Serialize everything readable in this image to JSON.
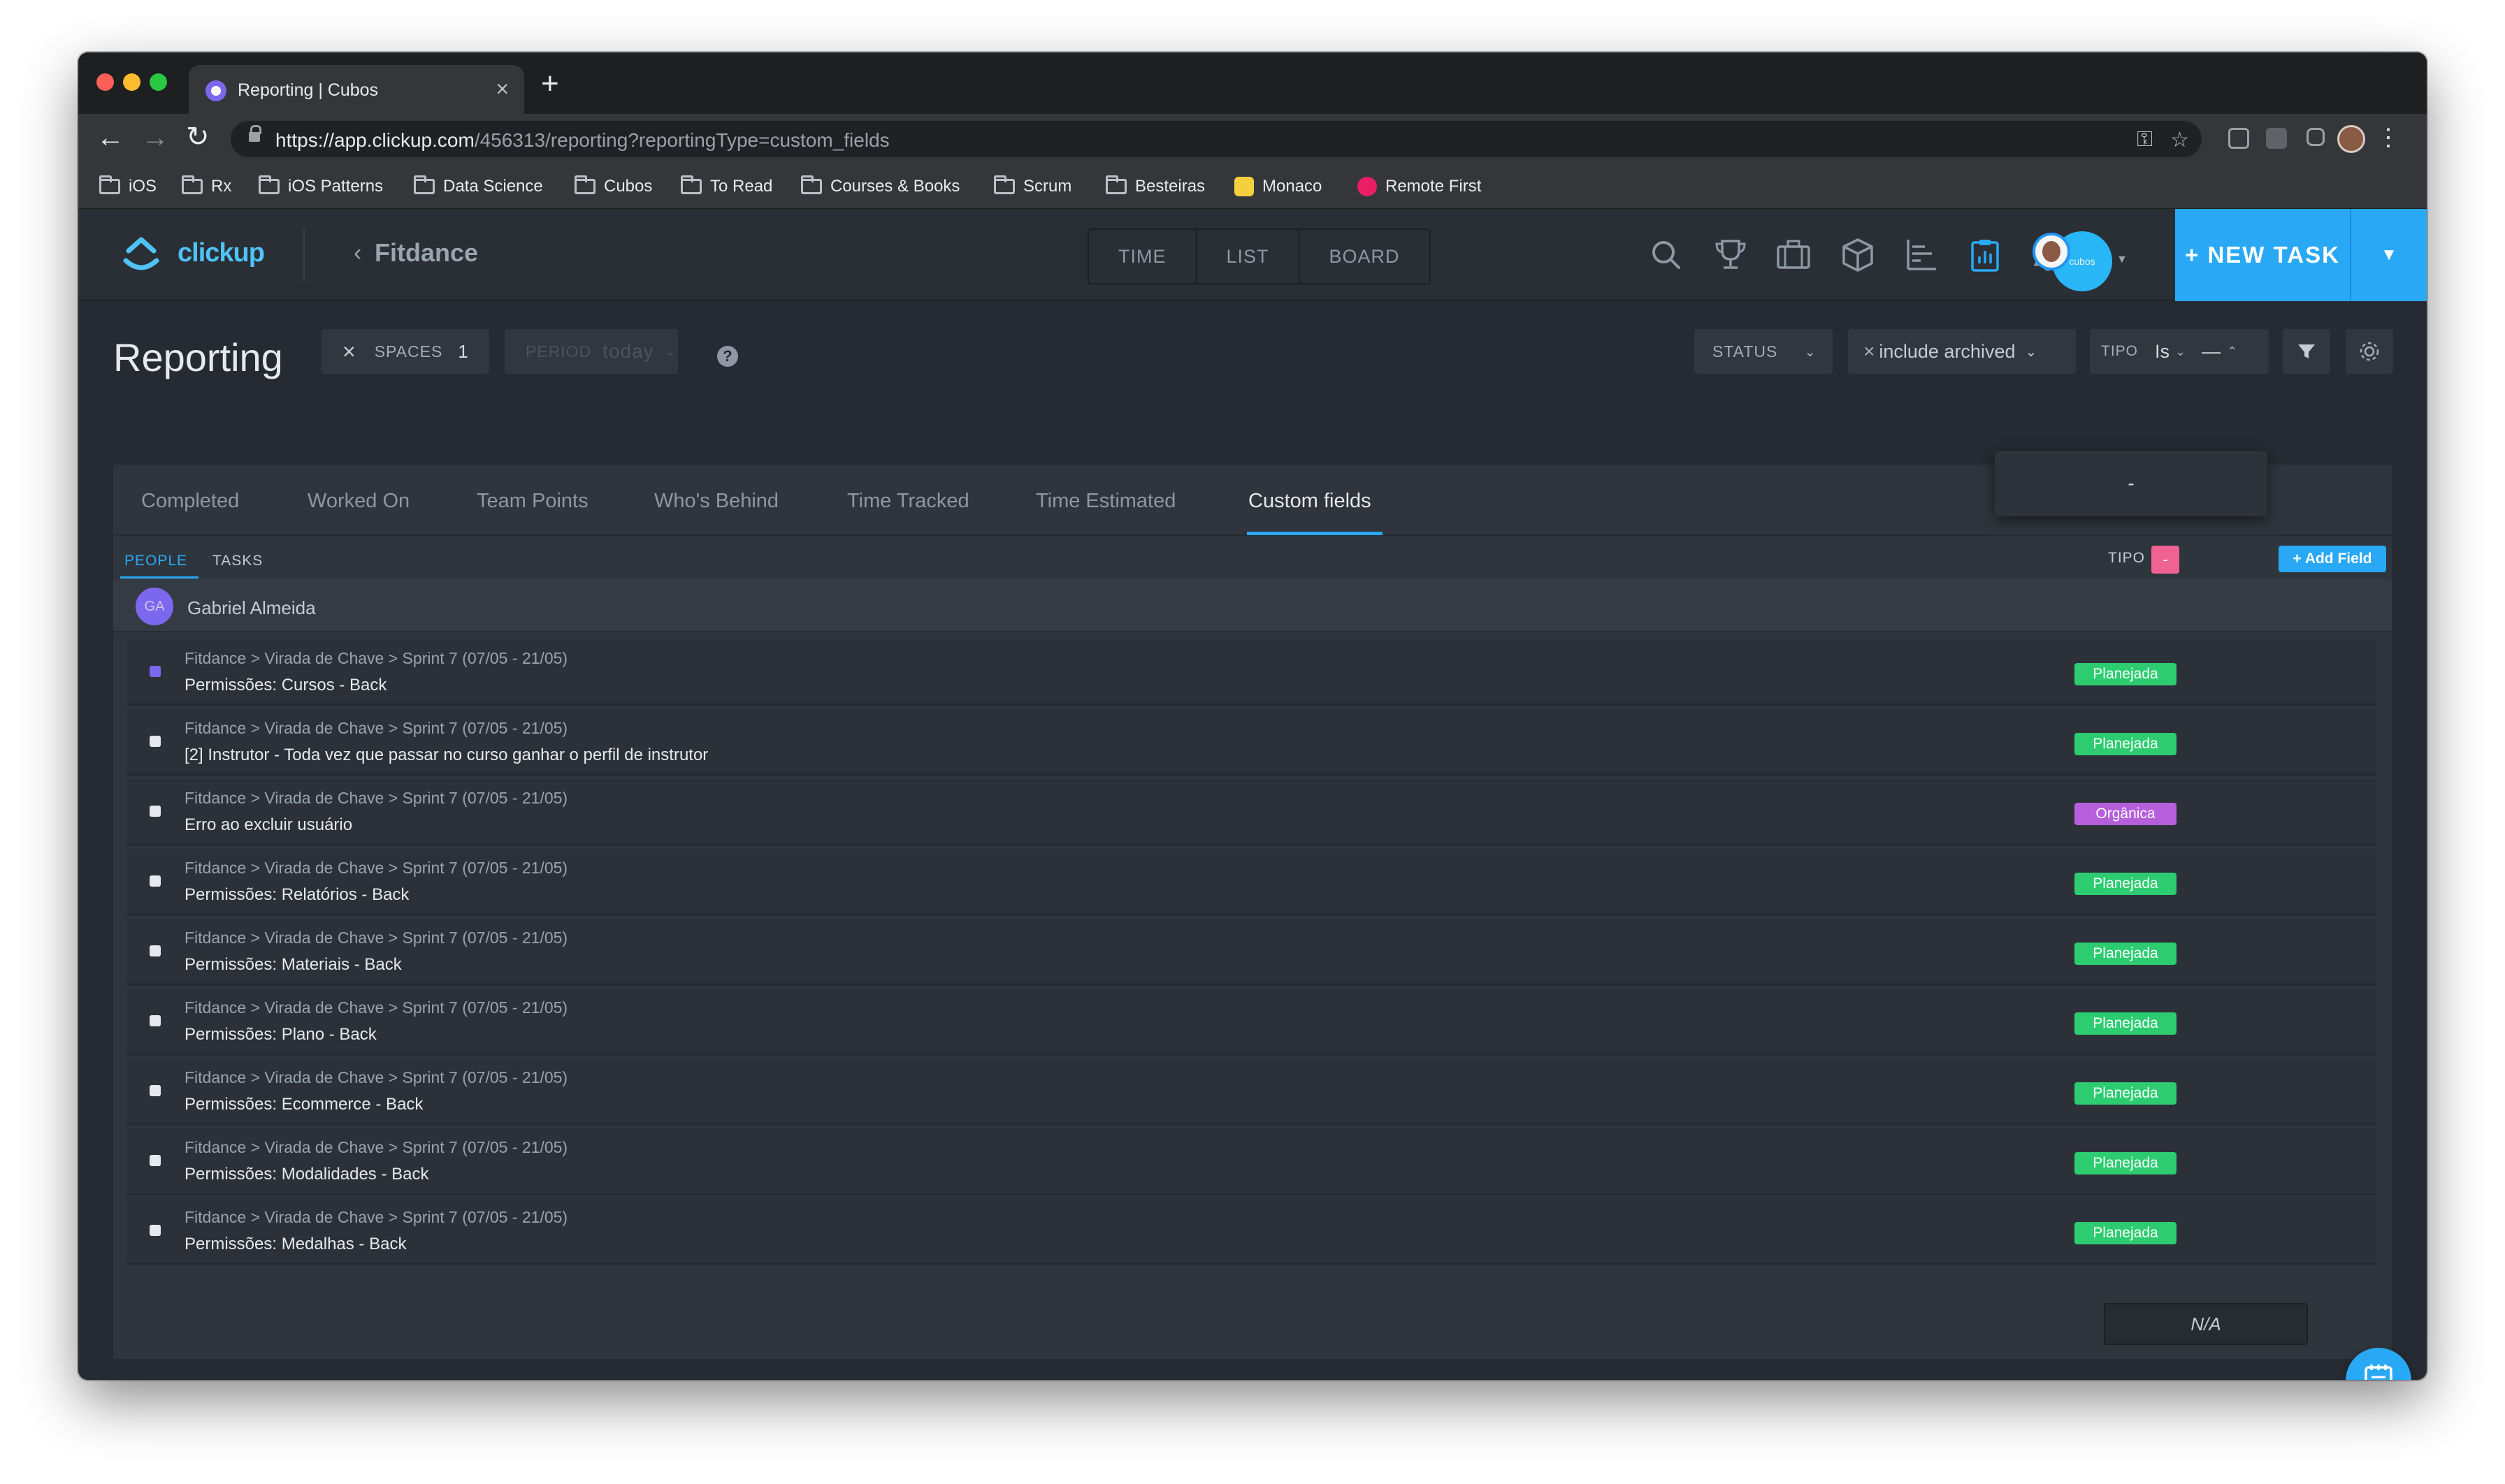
{
  "browser": {
    "tab_title": "Reporting | Cubos",
    "url_host": "https://app.clickup.com",
    "url_rest": "/456313/reporting?reportingType=custom_fields",
    "bookmarks": [
      "iOS",
      "Rx",
      "iOS Patterns",
      "Data Science",
      "Cubos",
      "To Read",
      "Courses & Books",
      "Scrum",
      "Besteiras",
      "Monaco",
      "Remote First"
    ]
  },
  "app": {
    "logo": "clickup",
    "project": "Fitdance",
    "views": [
      "TIME",
      "LIST",
      "BOARD"
    ],
    "team_avatar": "cubos",
    "new_task": "+ NEW TASK",
    "header_icons": [
      "search-icon",
      "trophy-icon",
      "briefcase-icon",
      "box-icon",
      "gantt-icon",
      "report-clipboard-icon",
      "bell-icon"
    ]
  },
  "filters": {
    "page_title": "Reporting",
    "spaces_label": "SPACES",
    "spaces_count": "1",
    "period_label": "PERIOD",
    "period_value": "today",
    "status_label": "STATUS",
    "archived_label": "include archived",
    "tipo_label": "TIPO",
    "tipo_op": "Is",
    "tipo_value": "—",
    "dropdown_option": "-"
  },
  "report": {
    "tabs": [
      "Completed",
      "Worked On",
      "Team Points",
      "Who's Behind",
      "Time Tracked",
      "Time Estimated",
      "Custom fields"
    ],
    "active_tab": "Custom fields",
    "subtabs": [
      "PEOPLE",
      "TASKS"
    ],
    "column_label": "TIPO",
    "column_badge": "-",
    "add_field": "+ Add Field",
    "person_initials": "GA",
    "person_name": "Gabriel Almeida",
    "tasks": [
      {
        "path": "Fitdance > Virada de Chave > Sprint 7 (07/05 - 21/05)",
        "name": "Permissões: Cursos - Back",
        "tipo": "Planejada",
        "dot_color": "#7b68ee"
      },
      {
        "path": "Fitdance > Virada de Chave > Sprint 7 (07/05 - 21/05)",
        "name": "[2] Instrutor - Toda vez que passar no curso ganhar o perfil de instrutor",
        "tipo": "Planejada",
        "dot_color": "#e6e9ee"
      },
      {
        "path": "Fitdance > Virada de Chave > Sprint 7 (07/05 - 21/05)",
        "name": "Erro ao excluir usuário",
        "tipo": "Orgânica",
        "dot_color": "#e6e9ee"
      },
      {
        "path": "Fitdance > Virada de Chave > Sprint 7 (07/05 - 21/05)",
        "name": "Permissões: Relatórios - Back",
        "tipo": "Planejada",
        "dot_color": "#e6e9ee"
      },
      {
        "path": "Fitdance > Virada de Chave > Sprint 7 (07/05 - 21/05)",
        "name": "Permissões: Materiais - Back",
        "tipo": "Planejada",
        "dot_color": "#e6e9ee"
      },
      {
        "path": "Fitdance > Virada de Chave > Sprint 7 (07/05 - 21/05)",
        "name": "Permissões: Plano - Back",
        "tipo": "Planejada",
        "dot_color": "#e6e9ee"
      },
      {
        "path": "Fitdance > Virada de Chave > Sprint 7 (07/05 - 21/05)",
        "name": "Permissões: Ecommerce - Back",
        "tipo": "Planejada",
        "dot_color": "#e6e9ee"
      },
      {
        "path": "Fitdance > Virada de Chave > Sprint 7 (07/05 - 21/05)",
        "name": "Permissões: Modalidades - Back",
        "tipo": "Planejada",
        "dot_color": "#e6e9ee"
      },
      {
        "path": "Fitdance > Virada de Chave > Sprint 7 (07/05 - 21/05)",
        "name": "Permissões: Medalhas - Back",
        "tipo": "Planejada",
        "dot_color": "#e6e9ee"
      }
    ],
    "tipo_colors": {
      "Planejada": "#2ecc71",
      "Orgânica": "#b65fdc"
    },
    "summary": "N/A"
  }
}
